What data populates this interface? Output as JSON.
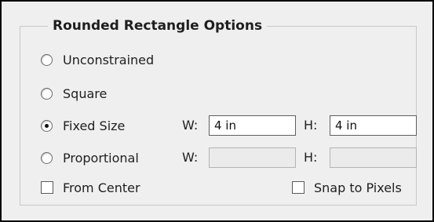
{
  "group": {
    "title": "Rounded Rectangle Options"
  },
  "options": {
    "unconstrained_label": "Unconstrained",
    "square_label": "Square",
    "fixed_size_label": "Fixed Size",
    "proportional_label": "Proportional",
    "selected": "Fixed Size"
  },
  "fixed_size": {
    "w_label": "W:",
    "w_value": "4 in",
    "h_label": "H:",
    "h_value": "4 in"
  },
  "proportional": {
    "w_label": "W:",
    "w_value": "",
    "h_label": "H:",
    "h_value": ""
  },
  "checkboxes": {
    "from_center_label": "From Center",
    "from_center_checked": false,
    "snap_to_pixels_label": "Snap to Pixels",
    "snap_to_pixels_checked": false
  }
}
